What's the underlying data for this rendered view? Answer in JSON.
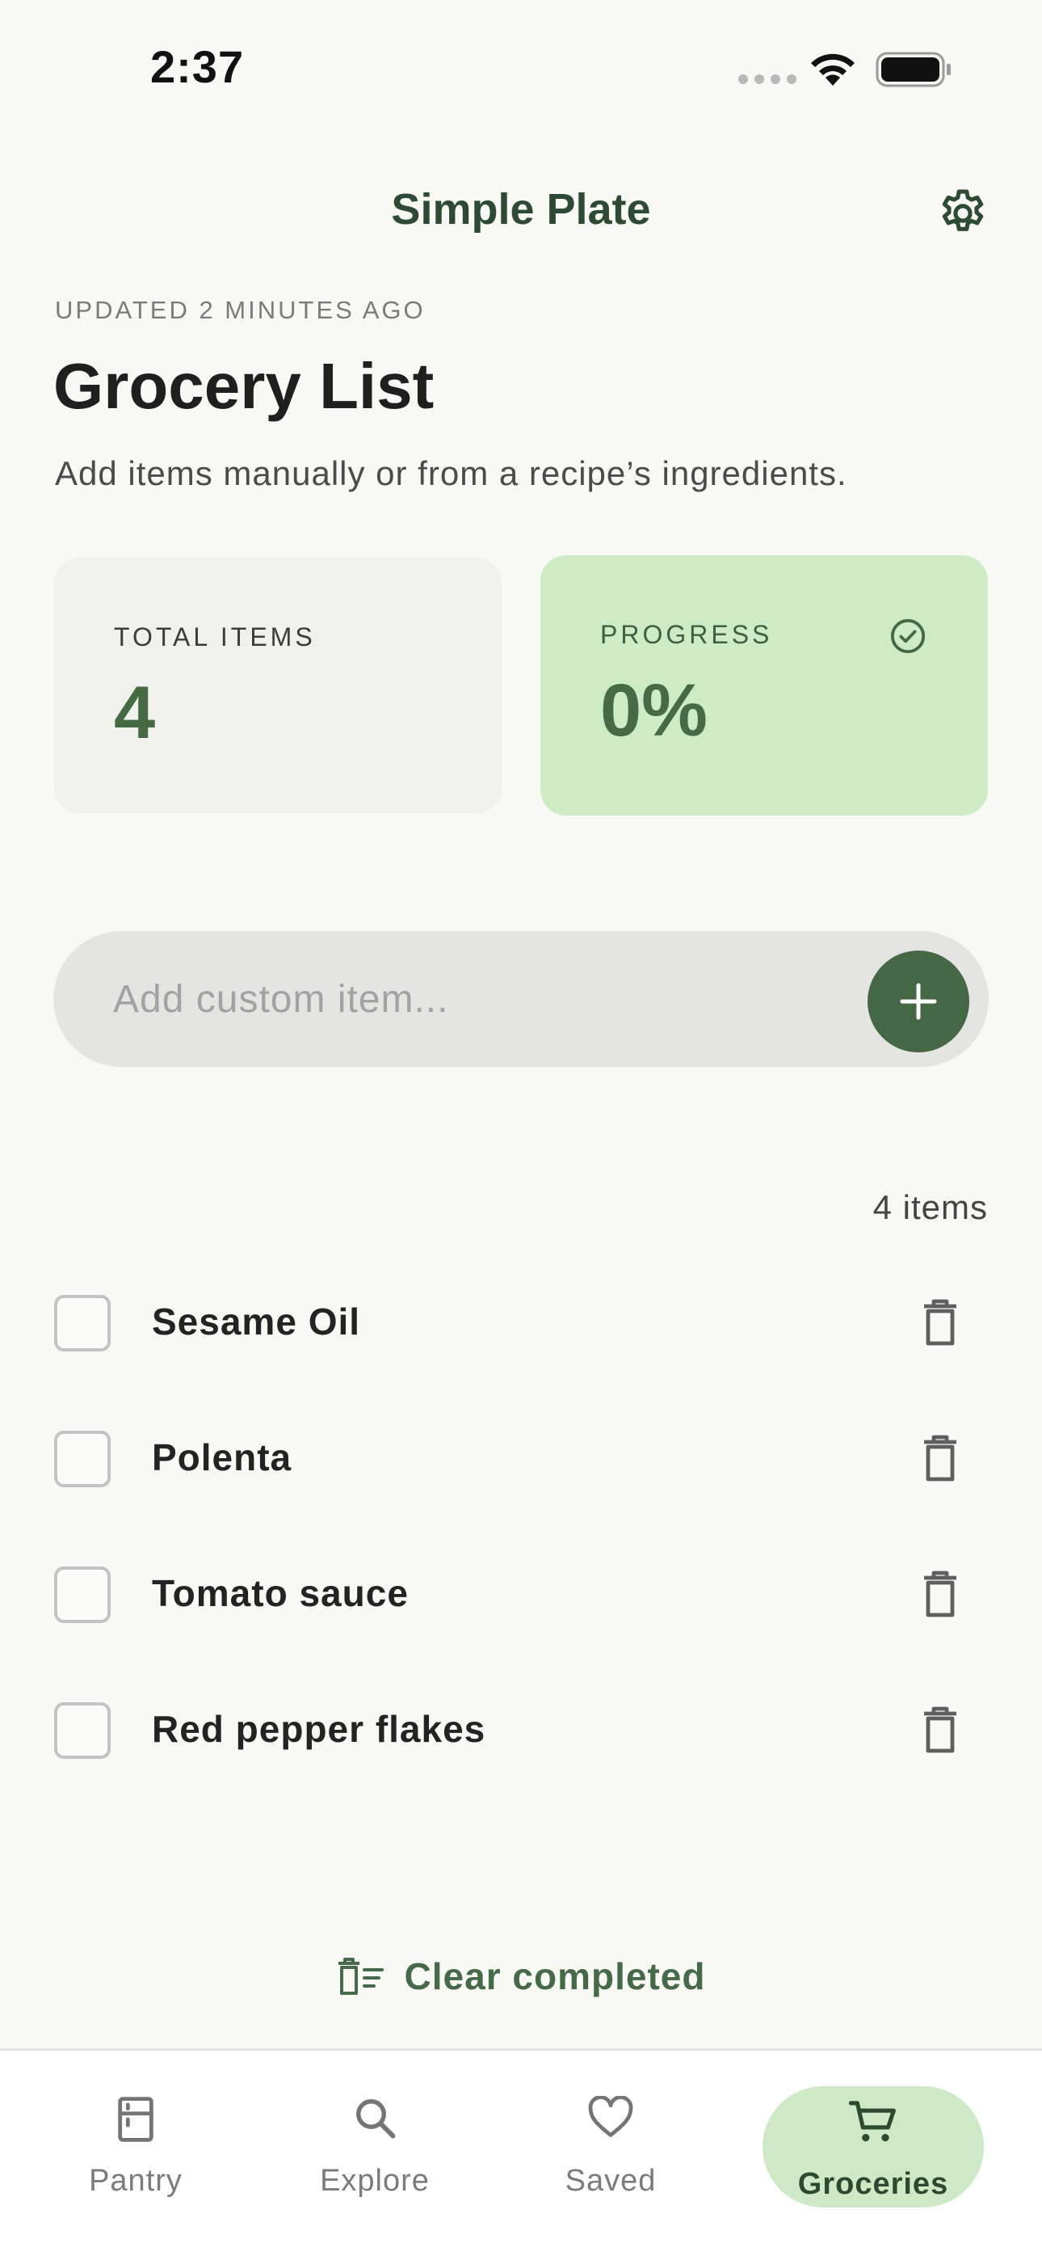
{
  "status_bar": {
    "time": "2:37"
  },
  "header": {
    "title": "Simple Plate",
    "settings_icon": "gear-icon"
  },
  "page": {
    "updated": "UPDATED 2 MINUTES AGO",
    "title": "Grocery List",
    "subtitle": "Add items manually or from a recipe’s ingredients."
  },
  "stats": {
    "total": {
      "label": "TOTAL ITEMS",
      "value": "4"
    },
    "progress": {
      "label": "PROGRESS",
      "value": "0%",
      "fraction": 0.0
    }
  },
  "add_item": {
    "placeholder": "Add custom item...",
    "value": ""
  },
  "list": {
    "count": "4 items",
    "items": [
      {
        "label": "Sesame Oil",
        "checked": false
      },
      {
        "label": "Polenta",
        "checked": false
      },
      {
        "label": "Tomato sauce",
        "checked": false
      },
      {
        "label": "Red pepper flakes",
        "checked": false
      }
    ]
  },
  "clear_completed": {
    "label": "Clear completed"
  },
  "nav": {
    "items": [
      {
        "label": "Pantry",
        "icon": "fridge-icon",
        "active": false
      },
      {
        "label": "Explore",
        "icon": "search-icon",
        "active": false
      },
      {
        "label": "Saved",
        "icon": "heart-icon",
        "active": false
      },
      {
        "label": "Groceries",
        "icon": "cart-icon",
        "active": true
      }
    ]
  },
  "colors": {
    "accent": "#456743",
    "accent_light": "#cdebc4",
    "background": "#f8f8f4"
  }
}
